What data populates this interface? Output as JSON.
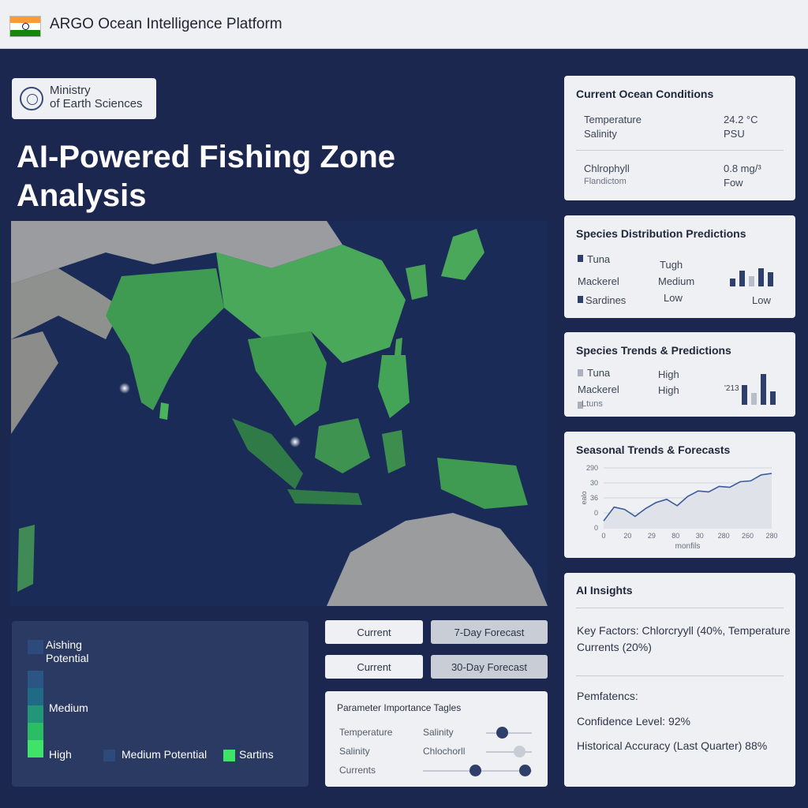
{
  "app": {
    "title": "ARGO Ocean Intelligence Platform"
  },
  "ministry": {
    "line1": "Ministry",
    "line2": "of Earth Sciences"
  },
  "page_title": "AI-Powered Fishing Zone Analysis",
  "legend": {
    "title_line1": "Aishing",
    "title_line2": "Potential",
    "medium": "Medium",
    "high": "High",
    "medium_potential": "Medium Potential",
    "sartins": "Sartins",
    "colors": [
      "#2c4a7c",
      "#2a5584",
      "#1f6b85",
      "#229778",
      "#2bbd64",
      "#3fe36a"
    ]
  },
  "buttons": {
    "current_1": "Current",
    "forecast_7": "7-Day Forecast",
    "current_2": "Current",
    "forecast_30": "30-Day Forecast"
  },
  "params": {
    "title": "Parameter Importance Tagles",
    "left_labels": [
      "Temperature",
      "Salinity",
      "Currents"
    ],
    "right_labels": [
      "Salinity",
      "Chlochorll"
    ]
  },
  "ocean_conditions": {
    "title": "Current Ocean Conditions",
    "temperature_label": "Temperature",
    "temperature_value": "24.2 °C",
    "salinity_label": "Salinity",
    "salinity_value": "PSU",
    "chlorophyll_label": "Chlrophyll",
    "chlorophyll_value": "0.8 mg/³",
    "flandictom_label": "Flandictom",
    "flandictom_value": "Fow"
  },
  "species_distribution": {
    "title": "Species Distribution Predictions",
    "rows": [
      {
        "name": "Tuna",
        "level": "Tugh"
      },
      {
        "name": "Mackerel",
        "level": "Medium"
      },
      {
        "name": "Sardines",
        "level": "Low"
      }
    ],
    "right_label": "Low"
  },
  "species_trends": {
    "title": "Species Trends & Predictions",
    "rows": [
      {
        "name": "Tuna",
        "level": "High"
      },
      {
        "name": "Mackerel",
        "level": "High"
      },
      {
        "name": "Ltuns",
        "level": ""
      }
    ],
    "side_label": "'213"
  },
  "seasonal": {
    "title": "Seasonal Trends & Forecasts",
    "xlabel": "monfils",
    "ylabel": "ealo"
  },
  "ai_insights": {
    "title": "AI Insights",
    "key_factors_line1": "Key Factors: Chlorcryyll (40%, Temperature",
    "key_factors_line2": "Currents (20%)",
    "pemfatencs": "Pemfatencs:",
    "confidence": "Confidence Level: 92%",
    "accuracy": "Historical Accuracy (Last Quarter) 88%"
  },
  "chart_data": {
    "type": "line",
    "title": "Seasonal Trends & Forecasts",
    "xlabel": "monfils",
    "ylabel": "ealo",
    "x_tick_labels": [
      "0",
      "20",
      "29",
      "80",
      "30",
      "280",
      "260",
      "280"
    ],
    "y_tick_labels": [
      "290",
      "30",
      "36",
      "0",
      "0"
    ],
    "x": [
      0,
      1,
      2,
      3,
      4,
      5,
      6,
      7,
      8,
      9,
      10,
      11,
      12,
      13,
      14,
      15,
      16
    ],
    "values": [
      0.15,
      0.45,
      0.4,
      0.25,
      0.42,
      0.55,
      0.62,
      0.48,
      0.68,
      0.8,
      0.78,
      0.9,
      0.88,
      1.0,
      1.02,
      1.15,
      1.18
    ],
    "ylim": [
      0,
      1.3
    ],
    "grid": true,
    "fill": true
  }
}
